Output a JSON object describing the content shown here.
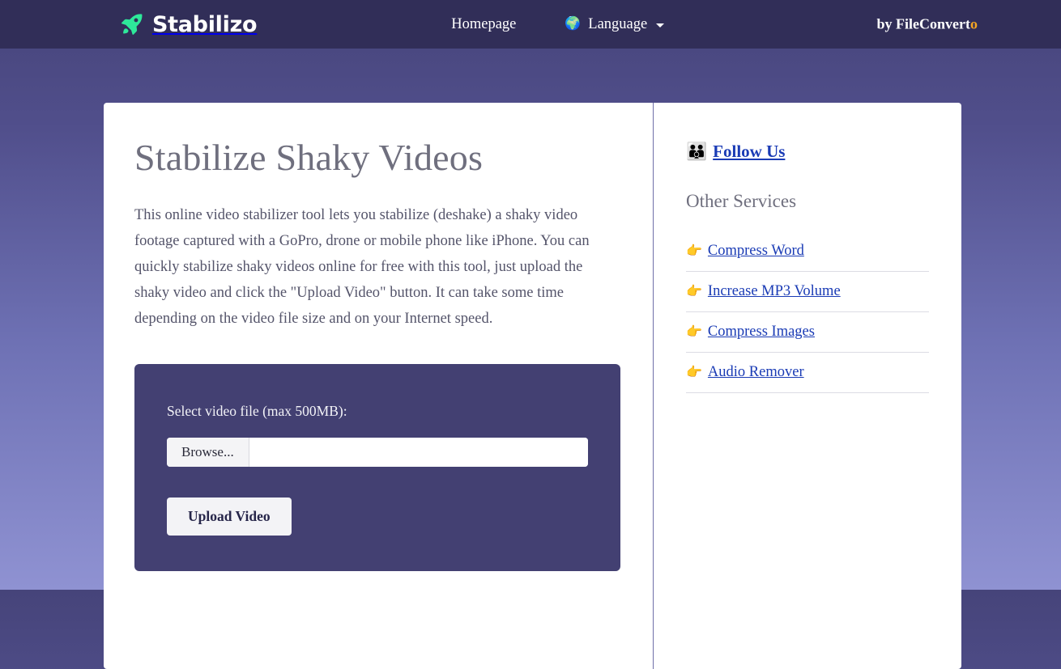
{
  "header": {
    "logo_icon": "rocket-icon",
    "brand": "Stabilizo",
    "nav": [
      {
        "label": "Homepage",
        "icon": null
      },
      {
        "label": "Language",
        "icon": "globe-icon",
        "has_caret": true
      }
    ],
    "byline_prefix": "by FileConvert",
    "byline_accent": "o",
    "bar_color": "#312e58",
    "accent_color": "#f5a623",
    "rocket_color": "#2ee89a"
  },
  "main": {
    "title": "Stabilize Shaky Videos",
    "intro": "This online video stabilizer tool lets you stabilize (deshake) a shaky video footage captured with a GoPro, drone or mobile phone like iPhone. You can quickly stabilize shaky videos online for free with this tool, just upload the shaky video and click the \"Upload Video\" button. It can take some time depending on the video file size and on your Internet speed.",
    "form": {
      "label": "Select video file (max 500MB):",
      "browse_label": "Browse...",
      "file_value": "",
      "file_placeholder": "",
      "submit_label": "Upload Video",
      "panel_color": "#434072"
    }
  },
  "sidebar": {
    "follow_icon": "family-emoji",
    "follow_label": "Follow Us",
    "services_heading": "Other Services",
    "services": [
      {
        "icon": "pointing-hand-icon",
        "label": "Compress Word"
      },
      {
        "icon": "pointing-hand-icon",
        "label": "Increase MP3 Volume"
      },
      {
        "icon": "pointing-hand-icon",
        "label": "Compress Images"
      },
      {
        "icon": "pointing-hand-icon",
        "label": "Audio Remover"
      }
    ],
    "link_color": "#1a3bb5"
  }
}
